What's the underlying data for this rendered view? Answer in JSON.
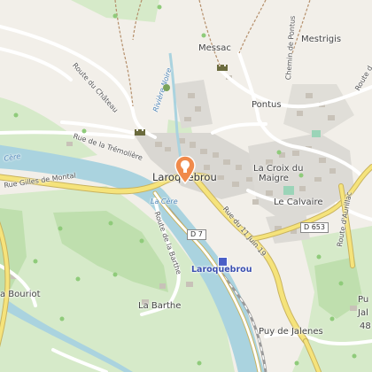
{
  "map": {
    "colors": {
      "land": "#f2efe9",
      "forest": "#d6eac9",
      "forest_dark": "#bfdfae",
      "river": "#aad3df",
      "road_major": "#f5e37b",
      "road_minor": "#ffffff",
      "built": "#d9d7d2",
      "pin": "#f08a4b"
    },
    "places": {
      "messac": "Messac",
      "mestrigis": "Mestrigis",
      "pontus": "Pontus",
      "la_croix_du_maigre_1": "La Croix du",
      "la_croix_du_maigre_2": "Maigre",
      "le_calvaire": "Le Calvaire",
      "la_bouriot": "a Bouriot",
      "la_barthe": "La Barthe",
      "puy_de_jalenes": "Puy de Jalenes",
      "edge_pu": "Pu",
      "edge_jal": "Jal",
      "edge_48": "48"
    },
    "town": "Laroquebrou",
    "station": "Laroquebrou",
    "roads": {
      "route_du_chateau": "Route du Château",
      "chemin_de_pontus": "Chemin de Pontus",
      "rue_de_la_tremoliere": "Rue de la Trémolière",
      "rue_gilles_de_montal": "Rue Gilles de Montal",
      "route_de_la_barthe": "Route de la Barthe",
      "rue_du_11_juin": "Rue du 11 Juin 19",
      "route_d_aurillac": "Route d'Aurillac",
      "route_d_edge": "Route d",
      "d7": "D 7",
      "d653": "D 653"
    },
    "water": {
      "riviere_noire": "Rivière Noire",
      "la_cere": "La Cère",
      "cere_edge": "Cère"
    },
    "icons": [
      "castle-icon",
      "map-pin-icon",
      "train-station-icon",
      "picnic-icon"
    ]
  }
}
